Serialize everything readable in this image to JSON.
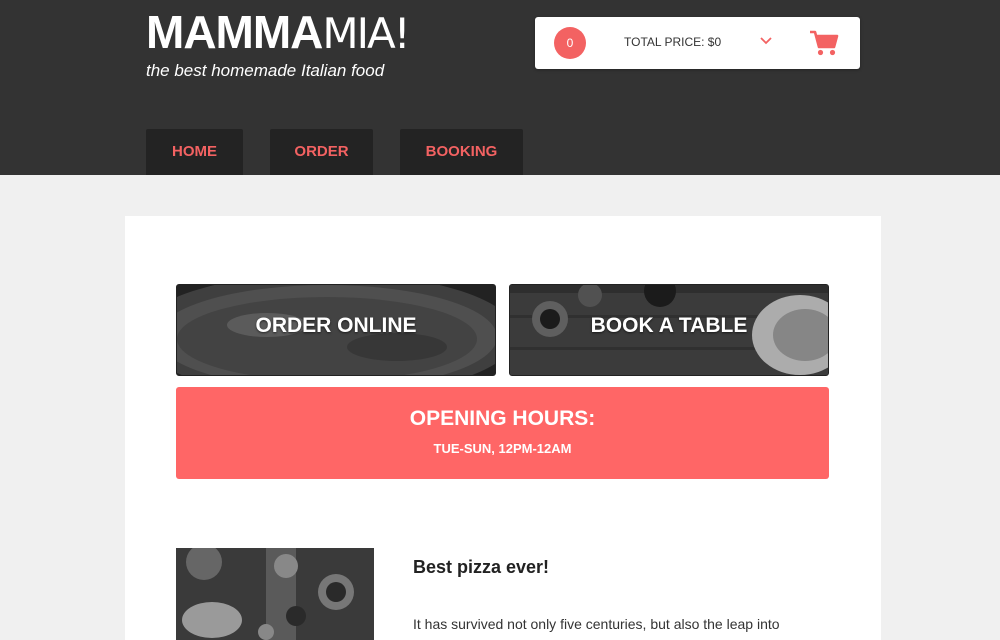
{
  "brand": {
    "name_bold": "MAMMA",
    "name_light": "MIA!",
    "tagline": "the best homemade Italian food"
  },
  "cart": {
    "count": "0",
    "total_label": "TOTAL PRICE: $0",
    "chevron_icon": "chevron-down-icon",
    "cart_icon": "shopping-cart-icon"
  },
  "nav": {
    "items": [
      {
        "label": "HOME"
      },
      {
        "label": "ORDER"
      },
      {
        "label": "BOOKING"
      }
    ]
  },
  "main": {
    "tiles": [
      {
        "label": "ORDER ONLINE",
        "image": "pizza-photo"
      },
      {
        "label": "BOOK A TABLE",
        "image": "table-photo"
      }
    ],
    "hours": {
      "title": "OPENING HOURS:",
      "times": "TUE-SUN, 12PM-12AM"
    },
    "review": {
      "title": "Best pizza ever!",
      "text": "It has survived not only five centuries, but also the leap into"
    }
  },
  "colors": {
    "header_bg": "#333333",
    "nav_bg": "#232323",
    "accent": "#ff6666",
    "page_bg": "#f0f0f0"
  }
}
